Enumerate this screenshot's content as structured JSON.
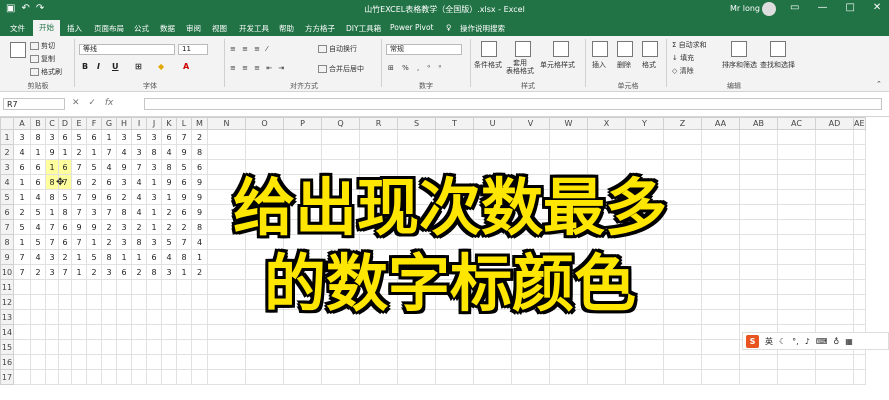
{
  "titlebar": {
    "title": "山竹EXCEL表格教学（全国版）.xlsx  -  Excel",
    "user": "Mr long"
  },
  "tabs": [
    "文件",
    "开始",
    "插入",
    "页面布局",
    "公式",
    "数据",
    "审阅",
    "视图",
    "开发工具",
    "帮助",
    "方方格子",
    "DIY工具箱",
    "Power Pivot",
    "操作说明搜索"
  ],
  "ribbon": {
    "cut": "剪切",
    "copy": "复制",
    "format_painter": "格式刷",
    "font_name": "等线",
    "font_size": "11",
    "wrap": "自动换行",
    "merge": "合并后居中",
    "number_format": "常规",
    "cond_format": "条件格式",
    "table_format": "套用\n表格格式",
    "cell_style": "单元格样式",
    "insert": "插入",
    "delete": "删除",
    "format": "格式",
    "autosum": "自动求和",
    "fill": "填充",
    "clear": "清除",
    "sort": "排序和筛选",
    "find": "查找和选择",
    "groups": [
      "剪贴板",
      "字体",
      "对齐方式",
      "数字",
      "样式",
      "单元格",
      "编辑"
    ],
    "font_btns": [
      "B",
      "I",
      "U"
    ]
  },
  "formula_bar": {
    "name_box": "R7",
    "fx": "fx",
    "value": ""
  },
  "columns": [
    "A",
    "B",
    "C",
    "D",
    "E",
    "F",
    "G",
    "H",
    "I",
    "J",
    "K",
    "L",
    "M",
    "N",
    "O",
    "P",
    "Q",
    "R",
    "S",
    "T",
    "U",
    "V",
    "W",
    "X",
    "Y",
    "Z",
    "AA",
    "AB",
    "AC",
    "AD",
    "AE"
  ],
  "rows": [
    [
      3,
      8,
      3,
      6,
      5,
      6,
      1,
      3,
      5,
      3,
      6,
      7,
      2
    ],
    [
      4,
      1,
      9,
      1,
      2,
      1,
      7,
      4,
      3,
      8,
      4,
      9,
      8
    ],
    [
      6,
      6,
      1,
      6,
      7,
      5,
      4,
      9,
      7,
      3,
      8,
      5,
      6
    ],
    [
      1,
      6,
      8,
      7,
      6,
      2,
      6,
      3,
      4,
      1,
      9,
      6,
      9
    ],
    [
      1,
      4,
      8,
      5,
      7,
      9,
      6,
      2,
      4,
      3,
      1,
      9,
      9
    ],
    [
      2,
      5,
      1,
      8,
      7,
      3,
      7,
      8,
      4,
      1,
      2,
      6,
      9
    ],
    [
      5,
      4,
      7,
      6,
      9,
      9,
      2,
      3,
      2,
      1,
      2,
      2,
      8
    ],
    [
      1,
      5,
      7,
      6,
      7,
      1,
      2,
      3,
      8,
      3,
      5,
      7,
      4
    ],
    [
      7,
      4,
      3,
      2,
      1,
      5,
      8,
      1,
      1,
      6,
      4,
      8,
      1
    ],
    [
      7,
      2,
      3,
      7,
      1,
      2,
      3,
      6,
      2,
      8,
      3,
      1,
      2
    ]
  ],
  "row_count": 17,
  "highlight_cells": [
    "C3",
    "D3",
    "C4",
    "D4"
  ],
  "overlay": {
    "line1": "给出现次数最多",
    "line2": "的数字标颜色"
  },
  "ime": {
    "badge": "S",
    "lang": "英"
  },
  "colors": {
    "accent": "#217346",
    "highlight": "#ffff9e",
    "overlay_text": "#ffe600"
  }
}
